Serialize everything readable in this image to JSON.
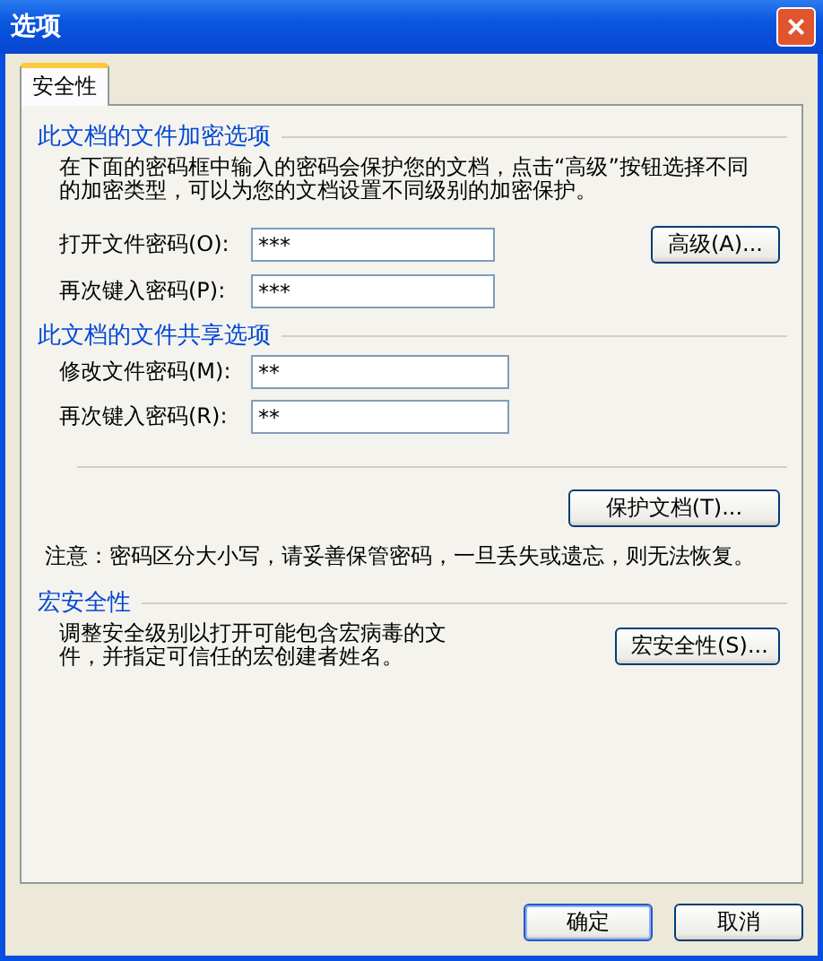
{
  "window": {
    "title": "选项",
    "close": "×"
  },
  "tabs": [
    {
      "label": "安全性",
      "selected": true
    }
  ],
  "encryption": {
    "heading": "此文档的文件加密选项",
    "description": "在下面的密码框中输入的密码会保护您的文档，点击“高级”按钮选择不同的加密类型，可以为您的文档设置不同级别的加密保护。",
    "fields": [
      {
        "label": "打开文件密码(O):",
        "value": "***"
      },
      {
        "label": "再次键入密码(P):",
        "value": "***"
      }
    ],
    "button": "高级(A)..."
  },
  "sharing": {
    "heading": "此文档的文件共享选项",
    "fields": [
      {
        "label": "修改文件密码(M):",
        "value": "**"
      },
      {
        "label": "再次键入密码(R):",
        "value": "**"
      }
    ],
    "button": "保护文档(T)...",
    "note": "注意：密码区分大小写，请妥善保管密码，一旦丢失或遗忘，则无法恢复。"
  },
  "macro": {
    "heading": "宏安全性",
    "description": "调整安全级别以打开可能包含宏病毒的文件，并指定可信任的宏创建者姓名。",
    "button": "宏安全性(S)..."
  },
  "buttons": [
    {
      "label": "确定",
      "default": true
    },
    {
      "label": "取消",
      "default": false
    }
  ]
}
